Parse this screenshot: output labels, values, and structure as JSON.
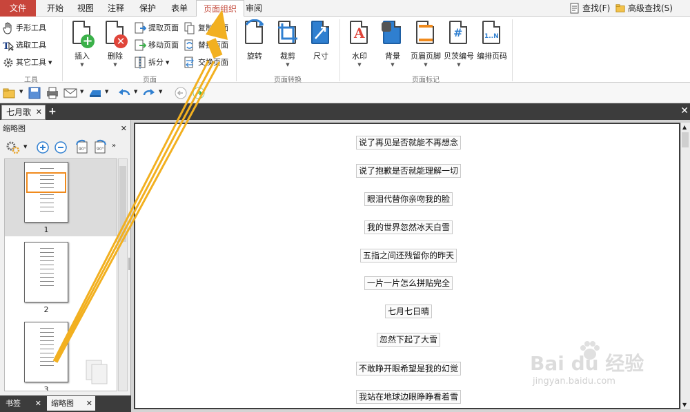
{
  "menu": {
    "tabs": [
      "文件",
      "开始",
      "视图",
      "注释",
      "保护",
      "表单",
      "页面组织",
      "审阅"
    ],
    "active_tab": "页面组织",
    "find": "查找(F)",
    "advanced_find": "高级查找(S)"
  },
  "ribbon": {
    "tools": {
      "items": [
        "手形工具",
        "选取工具",
        "其它工具"
      ],
      "group_label": "工具"
    },
    "page": {
      "insert": "插入",
      "delete": "删除",
      "extract": "提取页面",
      "move": "移动页面",
      "split": "拆分",
      "copy_page": "复制页面",
      "replace_page": "替换页面",
      "swap_page": "交换页面",
      "group_label": "页面"
    },
    "transform": {
      "rotate": "旋转",
      "crop": "裁剪",
      "size": "尺寸",
      "group_label": "页面转换"
    },
    "marks": {
      "watermark": "水印",
      "background": "背景",
      "header_footer": "页眉页脚",
      "bates": "贝茨编号",
      "page_num": "编排页码",
      "group_label": "页面标记"
    }
  },
  "doc_tab": {
    "title": "七月歌"
  },
  "sidebar": {
    "title": "缩略图",
    "pages": [
      "1",
      "2",
      "3"
    ],
    "bottom_tabs": [
      "书签",
      "缩略图"
    ]
  },
  "document": {
    "lines": [
      "说了再见是否就能不再想念",
      "说了抱歉是否就能理解一切",
      "眼泪代替你亲吻我的脸",
      "我的世界忽然冰天白雪",
      "五指之间还残留你的昨天",
      "一片一片怎么拼贴完全",
      "七月七日晴",
      "忽然下起了大雪",
      "不敢睁开眼希望是我的幻觉",
      "我站在地球边眼睁睁看着雪"
    ]
  },
  "watermark": {
    "brand": "Bai du 经验",
    "url": "jingyan.baidu.com"
  },
  "colors": {
    "file_tab": "#c8453b",
    "active_tab_text": "#c44a3b",
    "arrow": "#f2b020",
    "icon_blue": "#2f7fd0",
    "icon_green": "#3bb14a",
    "icon_red": "#e0453a",
    "icon_orange": "#f08a1c"
  }
}
